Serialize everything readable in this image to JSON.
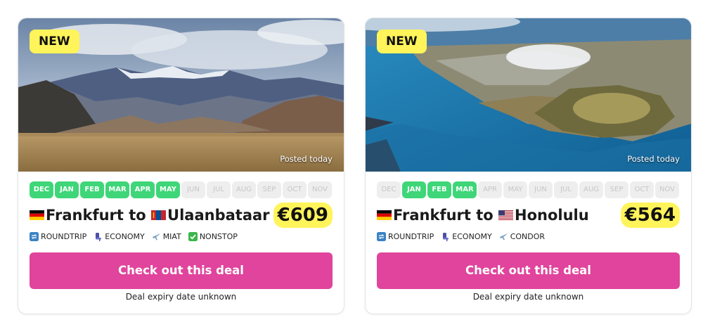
{
  "deals": [
    {
      "badge": "NEW",
      "posted": "Posted today",
      "months": [
        {
          "label": "DEC",
          "active": true
        },
        {
          "label": "JAN",
          "active": true
        },
        {
          "label": "FEB",
          "active": true
        },
        {
          "label": "MAR",
          "active": true
        },
        {
          "label": "APR",
          "active": true
        },
        {
          "label": "MAY",
          "active": true
        },
        {
          "label": "JUN",
          "active": false
        },
        {
          "label": "JUL",
          "active": false
        },
        {
          "label": "AUG",
          "active": false
        },
        {
          "label": "SEP",
          "active": false
        },
        {
          "label": "OCT",
          "active": false
        },
        {
          "label": "NOV",
          "active": false
        }
      ],
      "origin": "Frankfurt",
      "origin_flag": "germany-flag",
      "to_word": "to",
      "destination": "Ulaanbataar",
      "destination_flag": "mongolia-flag",
      "price": "€609",
      "tags": [
        {
          "icon": "roundtrip-icon",
          "label": "ROUNDTRIP"
        },
        {
          "icon": "seat-icon",
          "label": "ECONOMY"
        },
        {
          "icon": "plane-icon",
          "label": "MIAT"
        },
        {
          "icon": "check-icon",
          "label": "NONSTOP"
        }
      ],
      "cta": "Check out this deal",
      "expiry": "Deal expiry date unknown"
    },
    {
      "badge": "NEW",
      "posted": "Posted today",
      "months": [
        {
          "label": "DEC",
          "active": false
        },
        {
          "label": "JAN",
          "active": true
        },
        {
          "label": "FEB",
          "active": true
        },
        {
          "label": "MAR",
          "active": true
        },
        {
          "label": "APR",
          "active": false
        },
        {
          "label": "MAY",
          "active": false
        },
        {
          "label": "JUN",
          "active": false
        },
        {
          "label": "JUL",
          "active": false
        },
        {
          "label": "AUG",
          "active": false
        },
        {
          "label": "SEP",
          "active": false
        },
        {
          "label": "OCT",
          "active": false
        },
        {
          "label": "NOV",
          "active": false
        }
      ],
      "origin": "Frankfurt",
      "origin_flag": "germany-flag",
      "to_word": "to",
      "destination": "Honolulu",
      "destination_flag": "usa-flag",
      "price": "€564",
      "tags": [
        {
          "icon": "roundtrip-icon",
          "label": "ROUNDTRIP"
        },
        {
          "icon": "seat-icon",
          "label": "ECONOMY"
        },
        {
          "icon": "plane-icon",
          "label": "CONDOR"
        }
      ],
      "cta": "Check out this deal",
      "expiry": "Deal expiry date unknown"
    }
  ],
  "colors": {
    "accent_pink": "#e0449c",
    "highlight_yellow": "#fff45a",
    "month_active": "#3ed678",
    "month_inactive": "#eeeeee"
  }
}
